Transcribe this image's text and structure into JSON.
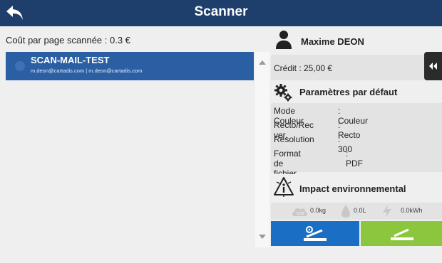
{
  "header": {
    "title": "Scanner",
    "color": "#1e3f6c"
  },
  "left": {
    "cost_label": "Coût par page scannée : 0.3 €",
    "items": [
      {
        "name": "SCAN-MAIL-TEST",
        "emails": "m.deon@cartadis.com | m.deon@cartadis.com"
      }
    ]
  },
  "user": {
    "name": "Maxime DEON",
    "credit": "Crédit : 25,00 €"
  },
  "settings": {
    "title": "Paramètres par défaut",
    "rows": [
      {
        "key": "Mode Couleur",
        "value": ": Couleur"
      },
      {
        "key": "Recto/Rec ver.",
        "value": ": Recto"
      },
      {
        "key": "Résolution",
        "value": ": 300"
      },
      {
        "key": "Format de fichier",
        "value": ": PDF"
      }
    ]
  },
  "impact": {
    "title": "Impact environnemental",
    "co2": "0.0kg",
    "water": "0.0L",
    "energy": "0.0kWh"
  },
  "actions": {
    "blue_color": "#1a6fc4",
    "green_color": "#8cc63f"
  }
}
